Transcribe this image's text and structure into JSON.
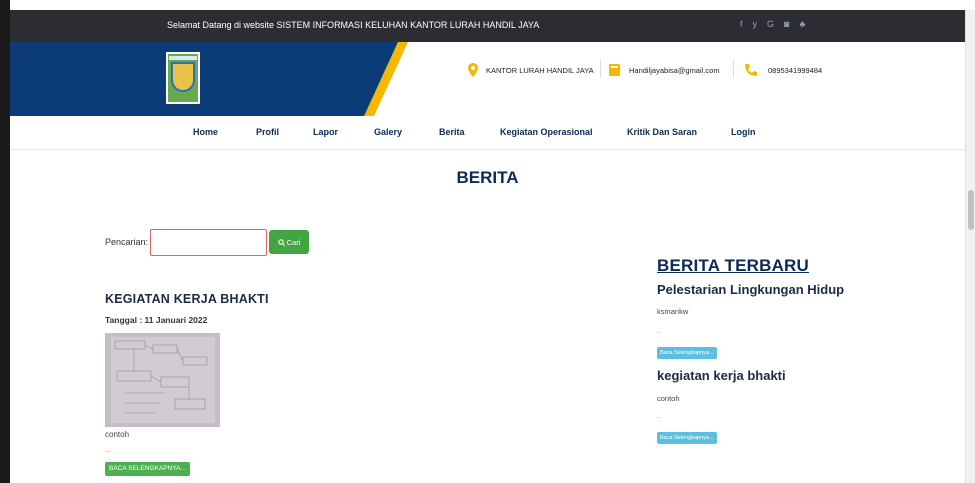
{
  "topbar": {
    "welcome": "Selamat Datang di website SISTEM INFORMASI KELUHAN KANTOR LURAH HANDIL JAYA",
    "social": [
      "f",
      "y",
      "G",
      "◙",
      "♣"
    ]
  },
  "header": {
    "office": "KANTOR LURAH HANDIL JAYA",
    "email": "Handiljayabisa@gmail.com",
    "phone": "0895341999484"
  },
  "nav": {
    "items": [
      "Home",
      "Profil",
      "Lapor",
      "Galery",
      "Berita",
      "Kegiatan Operasional",
      "Kritik Dan Saran",
      "Login"
    ]
  },
  "main": {
    "title": "BERITA",
    "search": {
      "label": "Pencarian:",
      "button": "Cari",
      "value": ""
    },
    "article": {
      "title": "KEGIATAN KERJA BHAKTI",
      "date": "Tanggal : 11 Januari 2022",
      "excerpt": "contoh",
      "dots": "...",
      "read_more": "BACA SELENGKAPNYA..."
    }
  },
  "sidebar": {
    "title": "BERITA TERBARU",
    "items": [
      {
        "title": "Pelestarian Lingkungan Hidup",
        "excerpt": "ksmankw",
        "dots": "..",
        "button": "Baca Selengkapnya..."
      },
      {
        "title": "kegiatan kerja bhakti",
        "excerpt": "contoh",
        "dots": "..",
        "button": "Baca Selengkapnya..."
      }
    ]
  },
  "colors": {
    "navy": "#0c3c78",
    "accent_yellow": "#f5b800",
    "button_green": "#43a443",
    "button_blue": "#5bc0de"
  }
}
